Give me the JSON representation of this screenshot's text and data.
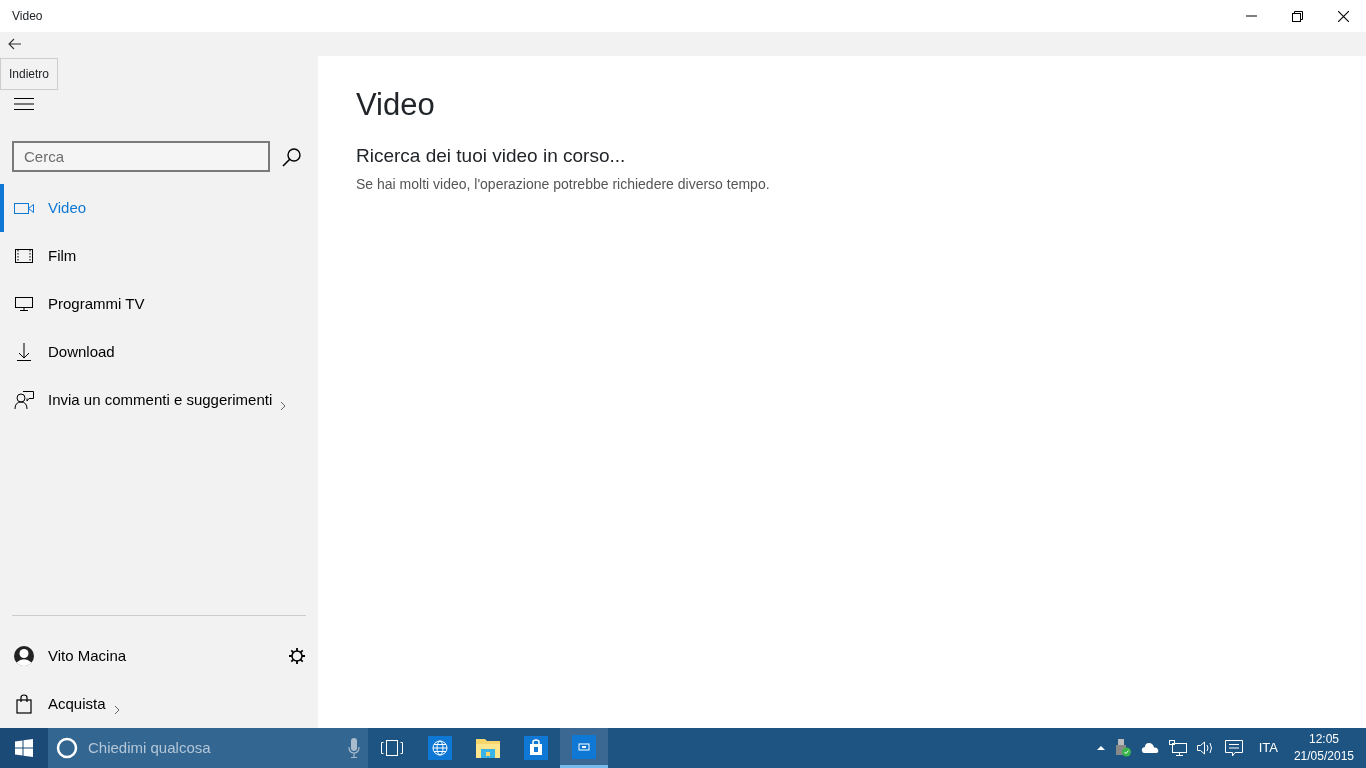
{
  "window": {
    "title": "Video"
  },
  "back_button": {
    "tooltip": "Indietro"
  },
  "search": {
    "placeholder": "Cerca"
  },
  "nav_items": [
    {
      "label": "Video",
      "selected": true,
      "submenu": false
    },
    {
      "label": "Film",
      "selected": false,
      "submenu": false
    },
    {
      "label": "Programmi TV",
      "selected": false,
      "submenu": false
    },
    {
      "label": "Download",
      "selected": false,
      "submenu": false
    },
    {
      "label": "Invia un commenti e suggerimenti",
      "selected": false,
      "submenu": true
    }
  ],
  "account": {
    "name": "Vito Macina"
  },
  "store": {
    "label": "Acquista",
    "submenu": true
  },
  "main": {
    "heading": "Video",
    "status_title": "Ricerca dei tuoi video in corso...",
    "status_text": "Se hai molti video, l'operazione potrebbe richiedere diverso tempo."
  },
  "taskbar": {
    "search_placeholder": "Chiedimi qualcosa",
    "apps": [
      {
        "selected": false
      },
      {
        "selected": false
      },
      {
        "selected": false
      },
      {
        "selected": true
      }
    ],
    "language": "ITA",
    "time": "12:05",
    "date": "21/05/2015"
  }
}
